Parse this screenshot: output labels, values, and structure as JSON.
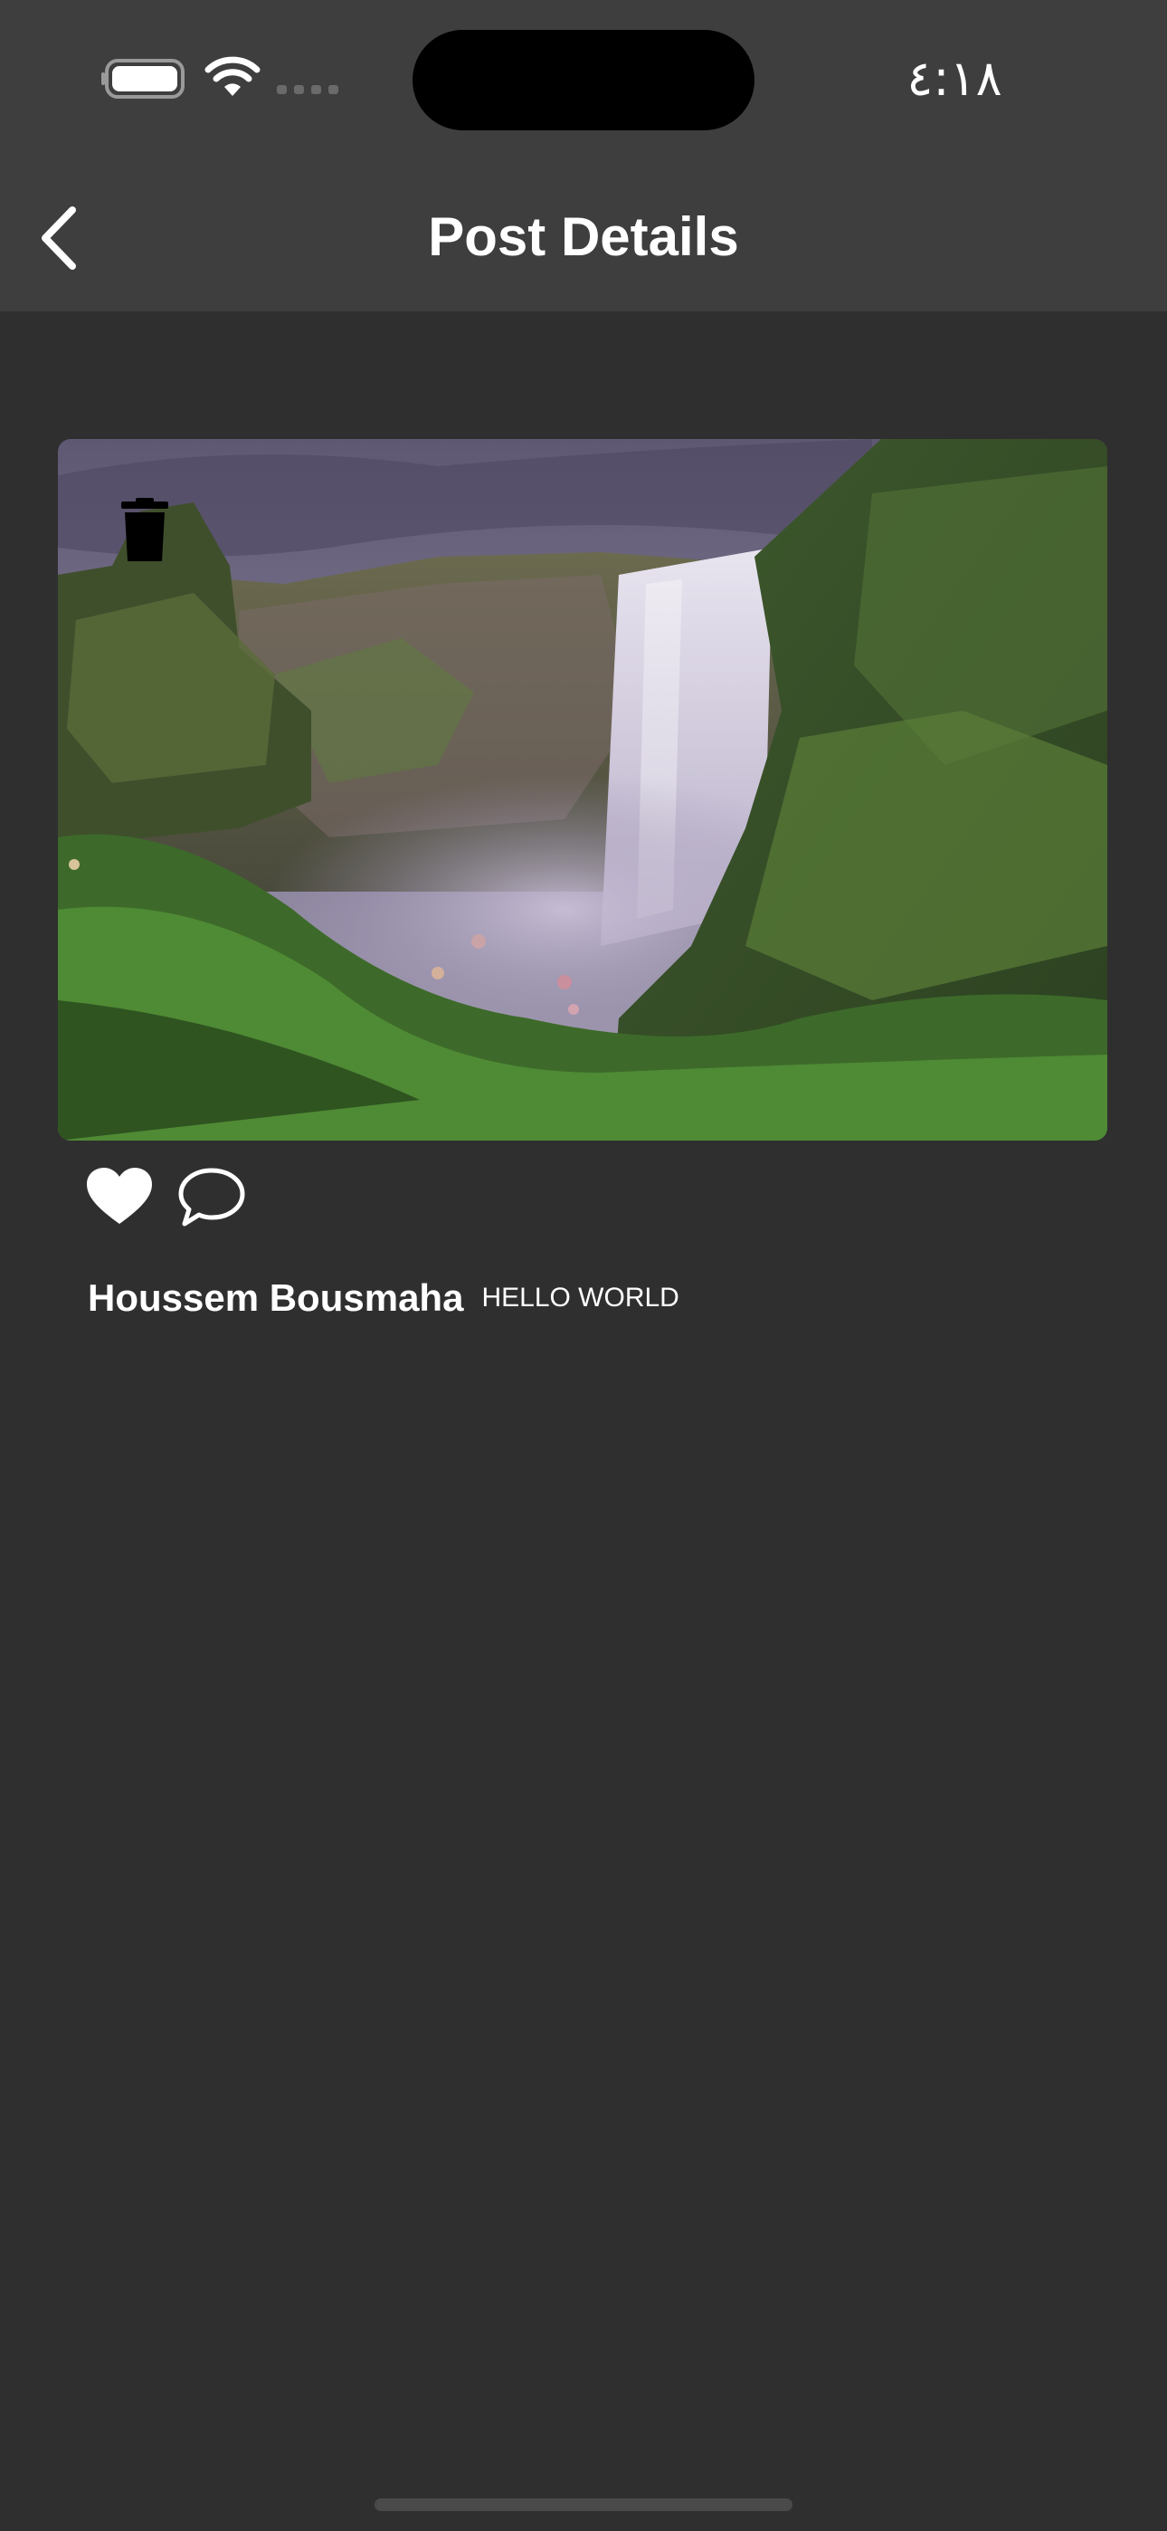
{
  "status_bar": {
    "time": "٤:١٨",
    "icons": [
      "battery-icon",
      "wifi-icon",
      "cellular-signal-icon"
    ]
  },
  "nav": {
    "title": "Post Details",
    "back_icon": "chevron-left-icon"
  },
  "post": {
    "image_description_icon": "photo",
    "delete_icon": "trash-icon",
    "like_icon": "heart-icon",
    "comment_icon": "speech-bubble-icon",
    "author": "Houssem Bousmaha",
    "text": "HELLO WORLD"
  },
  "colors": {
    "background": "#2f2f2f",
    "bar_surface": "#3e3e3e",
    "text": "#ffffff"
  }
}
